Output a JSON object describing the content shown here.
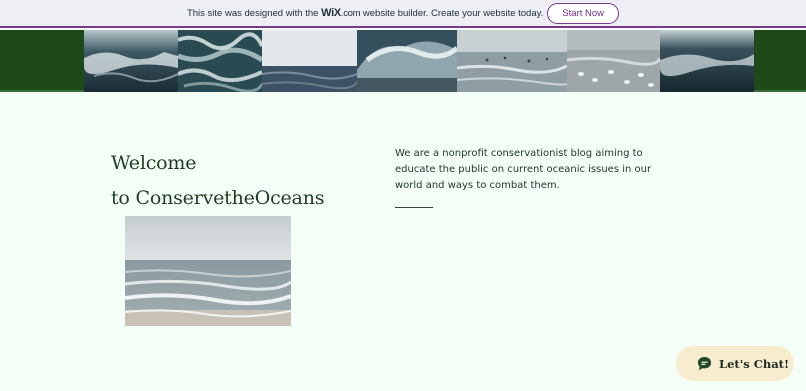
{
  "wix_bar": {
    "message_prefix": "This site was designed with the",
    "logo_mark": "WiX",
    "logo_suffix": ".com",
    "message_suffix": "website builder. Create your website today.",
    "cta_label": "Start Now"
  },
  "header": {
    "photos": [
      {
        "name": "crashing-wave-photo"
      },
      {
        "name": "foamy-water-photo"
      },
      {
        "name": "sea-horizon-photo"
      },
      {
        "name": "breaking-wave-photo"
      },
      {
        "name": "birds-on-shore-photo"
      },
      {
        "name": "seagulls-beach-photo"
      },
      {
        "name": "dark-wave-photo"
      }
    ]
  },
  "main": {
    "welcome_line1": "Welcome",
    "welcome_line2": "to ConservetheOceans",
    "intro_text": "We are a nonprofit conservationist blog aiming to educate the public on current oceanic issues in our world and ways to combat them."
  },
  "chat": {
    "label": "Let's Chat!"
  },
  "colors": {
    "page_bg": "#f4fff8",
    "header_green": "#1e4a1a",
    "wix_accent": "#7a3a8c",
    "chat_bg": "#f7eccd",
    "heading_text": "#1f3d22"
  }
}
